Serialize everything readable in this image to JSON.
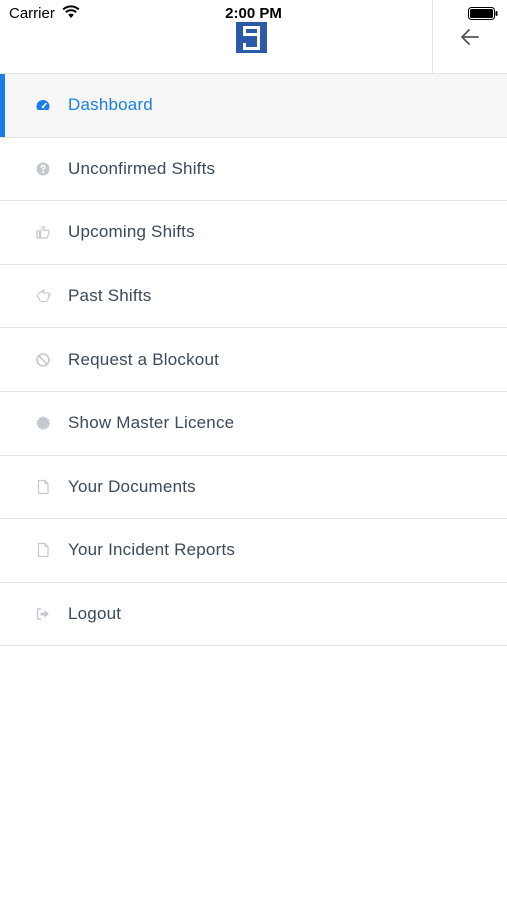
{
  "status_bar": {
    "carrier": "Carrier",
    "time": "2:00 PM"
  },
  "colors": {
    "accent": "#1a7fe4",
    "text": "#3b4a5a",
    "icon": "#c4c9cf",
    "logo": "#2a5aa8"
  },
  "header": {
    "logo_icon": "company-logo-icon",
    "back_icon": "arrow-left-icon"
  },
  "menu": {
    "items": [
      {
        "label": "Dashboard",
        "icon": "dashboard-icon",
        "active": true
      },
      {
        "label": "Unconfirmed Shifts",
        "icon": "question-circle-icon",
        "active": false
      },
      {
        "label": "Upcoming Shifts",
        "icon": "thumbs-up-icon",
        "active": false
      },
      {
        "label": "Past Shifts",
        "icon": "hand-left-icon",
        "active": false
      },
      {
        "label": "Request a Blockout",
        "icon": "ban-icon",
        "active": false
      },
      {
        "label": "Show Master Licence",
        "icon": "certificate-icon",
        "active": false
      },
      {
        "label": "Your Documents",
        "icon": "file-icon",
        "active": false
      },
      {
        "label": "Your Incident Reports",
        "icon": "file-icon",
        "active": false
      },
      {
        "label": "Logout",
        "icon": "sign-out-icon",
        "active": false
      }
    ]
  }
}
